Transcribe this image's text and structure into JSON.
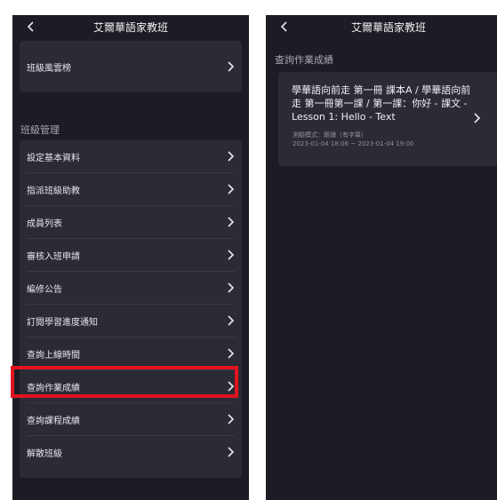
{
  "left": {
    "title": "艾爾華語家教班",
    "top_item": "班級風雲榜",
    "section_title": "班級管理",
    "items": [
      {
        "label": "設定基本資料"
      },
      {
        "label": "指派班級助教"
      },
      {
        "label": "成員列表"
      },
      {
        "label": "審核入班申請"
      },
      {
        "label": "編修公告"
      },
      {
        "label": "訂閱學習進度通知"
      },
      {
        "label": "查詢上線時間"
      },
      {
        "label": "查詢作業成績"
      },
      {
        "label": "查詢課程成績"
      },
      {
        "label": "解散班級"
      }
    ],
    "highlighted_item": "查詢作業成績"
  },
  "right": {
    "title": "艾爾華語家教班",
    "section_title": "查詢作業成績",
    "homework": {
      "title": "學華語向前走 第一冊 課本A / 學華語向前走 第一冊第一課 / 第一課：你好 - 課文 - Lesson 1: Hello - Text",
      "mode": "測驗模式：跟讀（有字幕）",
      "time_range": "2023-01-04 18:06 ~ 2023-01-04 19:00"
    }
  },
  "colors": {
    "background": "#1b1c24",
    "card": "#2a2b35",
    "highlight": "#e0131e"
  },
  "icons": [
    "back-icon",
    "chevron-right-icon"
  ]
}
